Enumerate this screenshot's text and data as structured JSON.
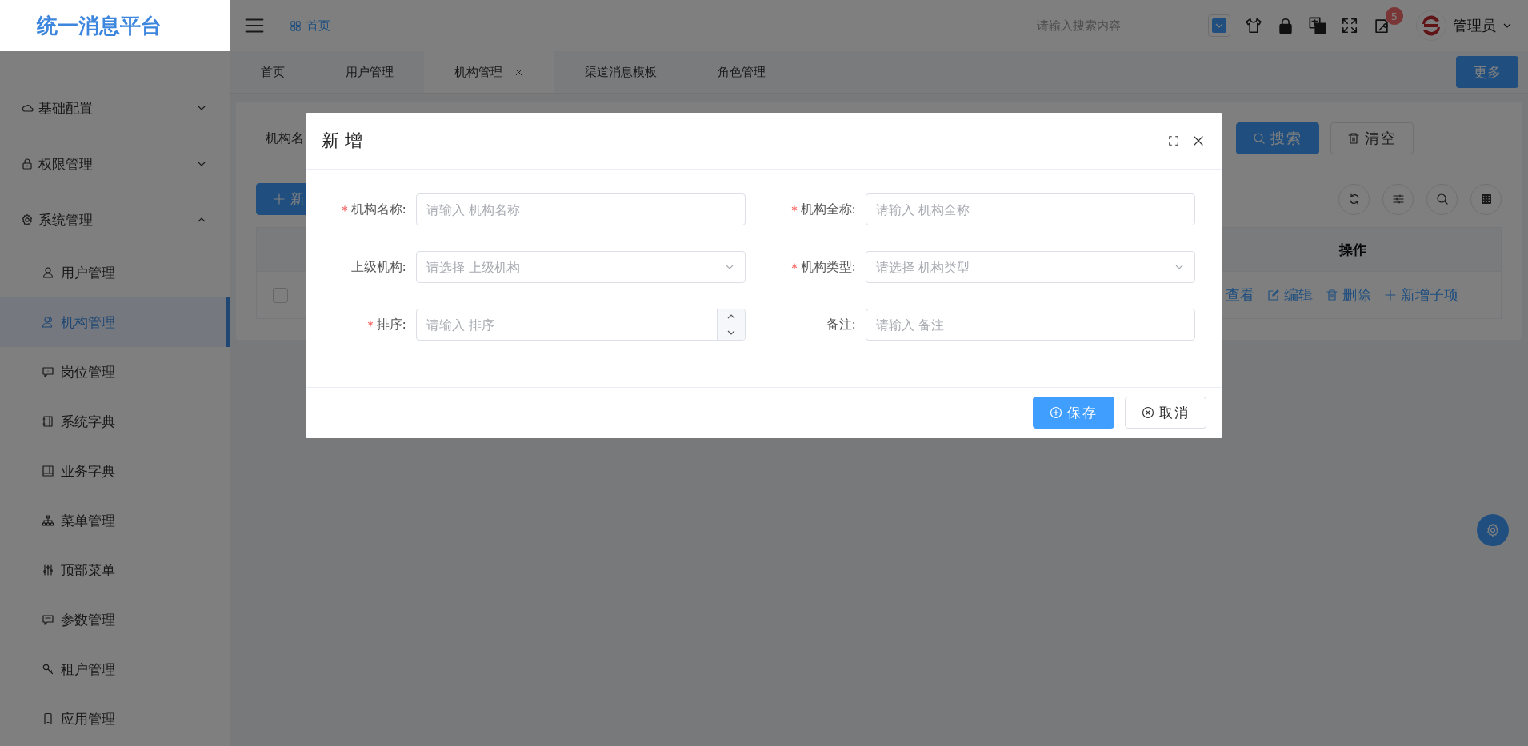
{
  "logo": "统一消息平台",
  "header": {
    "breadcrumb": "首页",
    "search": {
      "placeholder": "请输入搜索内容"
    },
    "badge": "5",
    "user": "管理员"
  },
  "sidebar": {
    "items": [
      {
        "label": "基础配置",
        "expanded": false
      },
      {
        "label": "权限管理",
        "expanded": false
      },
      {
        "label": "系统管理",
        "expanded": true,
        "children": [
          {
            "label": "用户管理",
            "selected": false
          },
          {
            "label": "机构管理",
            "selected": true
          },
          {
            "label": "岗位管理",
            "selected": false
          },
          {
            "label": "系统字典",
            "selected": false
          },
          {
            "label": "业务字典",
            "selected": false
          },
          {
            "label": "菜单管理",
            "selected": false
          },
          {
            "label": "顶部菜单",
            "selected": false
          },
          {
            "label": "参数管理",
            "selected": false
          },
          {
            "label": "租户管理",
            "selected": false
          },
          {
            "label": "应用管理",
            "selected": false
          }
        ]
      }
    ]
  },
  "tabs": [
    {
      "label": "首页",
      "selected": false
    },
    {
      "label": "用户管理",
      "selected": false
    },
    {
      "label": "机构管理",
      "selected": true
    },
    {
      "label": "渠道消息模板",
      "selected": false
    },
    {
      "label": "角色管理",
      "selected": false
    }
  ],
  "more_button": "更多",
  "search_form": {
    "label": "机构名",
    "buttons": [
      "搜索",
      "清空"
    ]
  },
  "add_button": "新",
  "table": {
    "columns": [
      "操作"
    ],
    "rows": [
      {
        "checked": false,
        "actions": [
          "查看",
          "编辑",
          "删除",
          "新增子项"
        ]
      }
    ]
  },
  "dialog": {
    "title": "新 增",
    "fields": [
      {
        "label": "机构名称:",
        "required": true,
        "kind": "input",
        "placeholder": "请输入 机构名称"
      },
      {
        "label": "机构全称:",
        "required": true,
        "kind": "input",
        "placeholder": "请输入 机构全称"
      },
      {
        "label": "上级机构:",
        "required": false,
        "kind": "select",
        "placeholder": "请选择 上级机构"
      },
      {
        "label": "机构类型:",
        "required": true,
        "kind": "select",
        "placeholder": "请选择 机构类型"
      },
      {
        "label": "排序:",
        "required": true,
        "kind": "number",
        "placeholder": "请输入 排序"
      },
      {
        "label": "备注:",
        "required": false,
        "kind": "input",
        "placeholder": "请输入 备注"
      }
    ],
    "buttons": [
      {
        "label": "保存",
        "kind": "primary"
      },
      {
        "label": "取消",
        "kind": "default"
      }
    ]
  }
}
